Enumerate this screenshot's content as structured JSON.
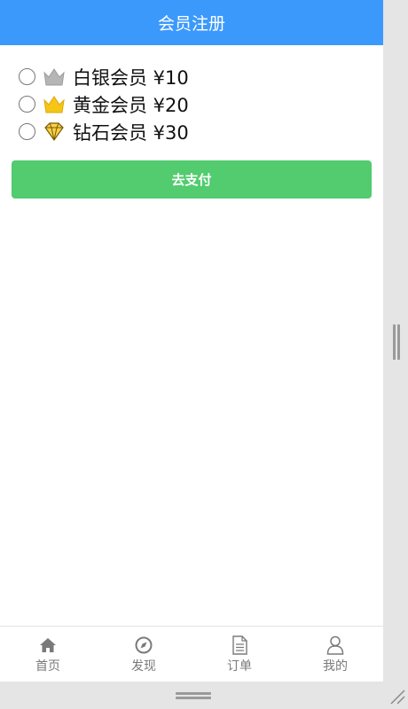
{
  "header": {
    "title": "会员注册"
  },
  "plans": [
    {
      "label": "白银会员 ¥10",
      "icon": "silver-crown-icon"
    },
    {
      "label": "黄金会员 ¥20",
      "icon": "gold-crown-icon"
    },
    {
      "label": "钻石会员 ¥30",
      "icon": "diamond-icon"
    }
  ],
  "pay_button": {
    "label": "去支付"
  },
  "tabbar": {
    "items": [
      {
        "label": "首页",
        "icon": "home-icon"
      },
      {
        "label": "发现",
        "icon": "compass-icon"
      },
      {
        "label": "订单",
        "icon": "document-icon"
      },
      {
        "label": "我的",
        "icon": "user-icon"
      }
    ]
  },
  "colors": {
    "header_bg": "#3c99fc",
    "pay_button_bg": "#52cc6e",
    "tab_text": "#7a7a7a"
  }
}
